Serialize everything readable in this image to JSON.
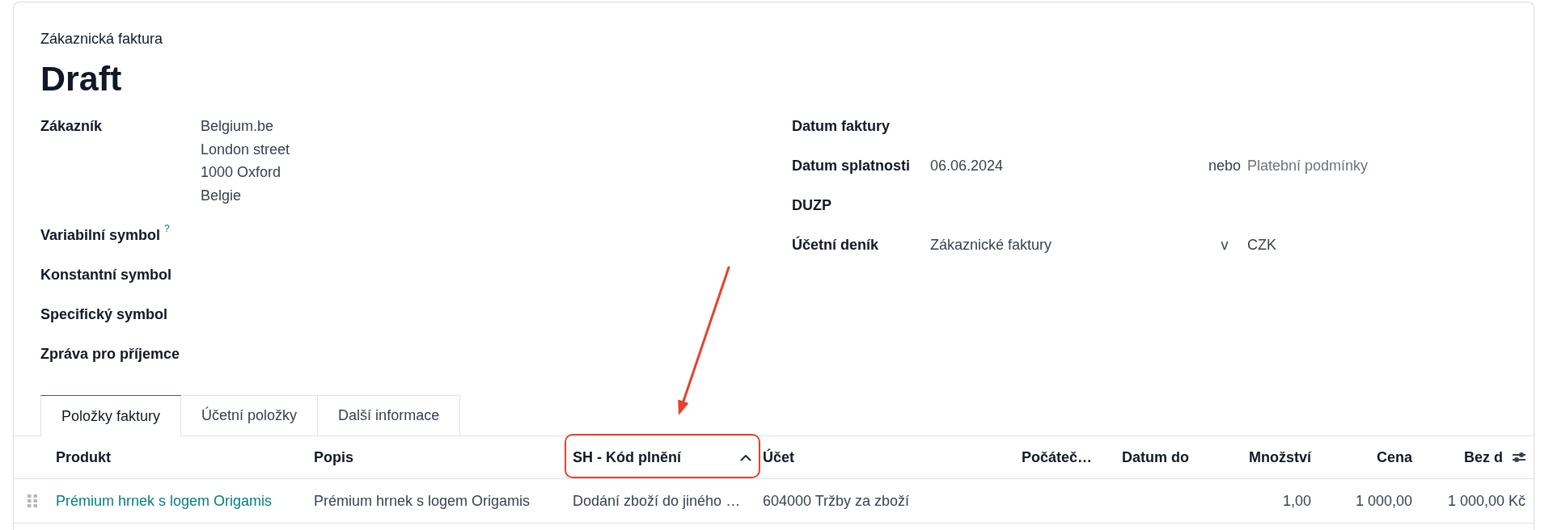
{
  "sheet": {
    "subtitle": "Zákaznická faktura",
    "title": "Draft"
  },
  "left_fields": [
    {
      "label": "Zákazník",
      "value_lines": [
        "Belgium.be",
        "London street",
        "1000 Oxford",
        "Belgie"
      ]
    },
    {
      "label": "Variabilní symbol",
      "help": "?"
    },
    {
      "label": "Konstantní symbol"
    },
    {
      "label": "Specifický symbol"
    },
    {
      "label": "Zpráva pro příjemce"
    }
  ],
  "right_fields": [
    {
      "label": "Datum faktury"
    },
    {
      "label": "Datum splatnosti",
      "value": "06.06.2024",
      "connector": "nebo",
      "second_field": {
        "placeholder": "Platební podmínky"
      }
    },
    {
      "label": "DUZP"
    },
    {
      "label": "Účetní deník",
      "value": "Zákaznické faktury",
      "connector": "v",
      "second_field": {
        "value": "CZK"
      }
    }
  ],
  "tabs": [
    {
      "label": "Položky faktury",
      "selected": true
    },
    {
      "label": "Účetní položky",
      "selected": false
    },
    {
      "label": "Další informace",
      "selected": false
    }
  ],
  "table": {
    "columns": [
      {
        "label": "Produkt",
        "kind": "link",
        "sorted": false,
        "highlighted": false,
        "values": [
          "Prémium hrnek s logem Origamis"
        ]
      },
      {
        "label": "Popis",
        "kind": "text",
        "sorted": false,
        "highlighted": false,
        "values": [
          "Prémium hrnek s logem Origamis"
        ]
      },
      {
        "label": "SH - Kód plnění",
        "kind": "text",
        "sorted": true,
        "highlighted": true,
        "values": [
          "Dodání zboží do jiného …"
        ]
      },
      {
        "label": "Účet",
        "kind": "text",
        "sorted": false,
        "highlighted": false,
        "values": [
          "604000 Tržby za zboží"
        ]
      },
      {
        "label": "Počáteč…",
        "kind": "text",
        "sorted": false,
        "highlighted": false
      },
      {
        "label": "Datum do",
        "kind": "text",
        "sorted": false,
        "highlighted": false
      },
      {
        "label": "Množství",
        "kind": "number",
        "sorted": false,
        "highlighted": false,
        "values": [
          "1,00"
        ]
      },
      {
        "label": "Cena",
        "kind": "number",
        "sorted": false,
        "highlighted": false,
        "values": [
          "1 000,00"
        ]
      },
      {
        "label": "Bez d",
        "kind": "number",
        "sorted": false,
        "highlighted": false,
        "values": [
          "1 000,00 Kč"
        ]
      }
    ]
  }
}
